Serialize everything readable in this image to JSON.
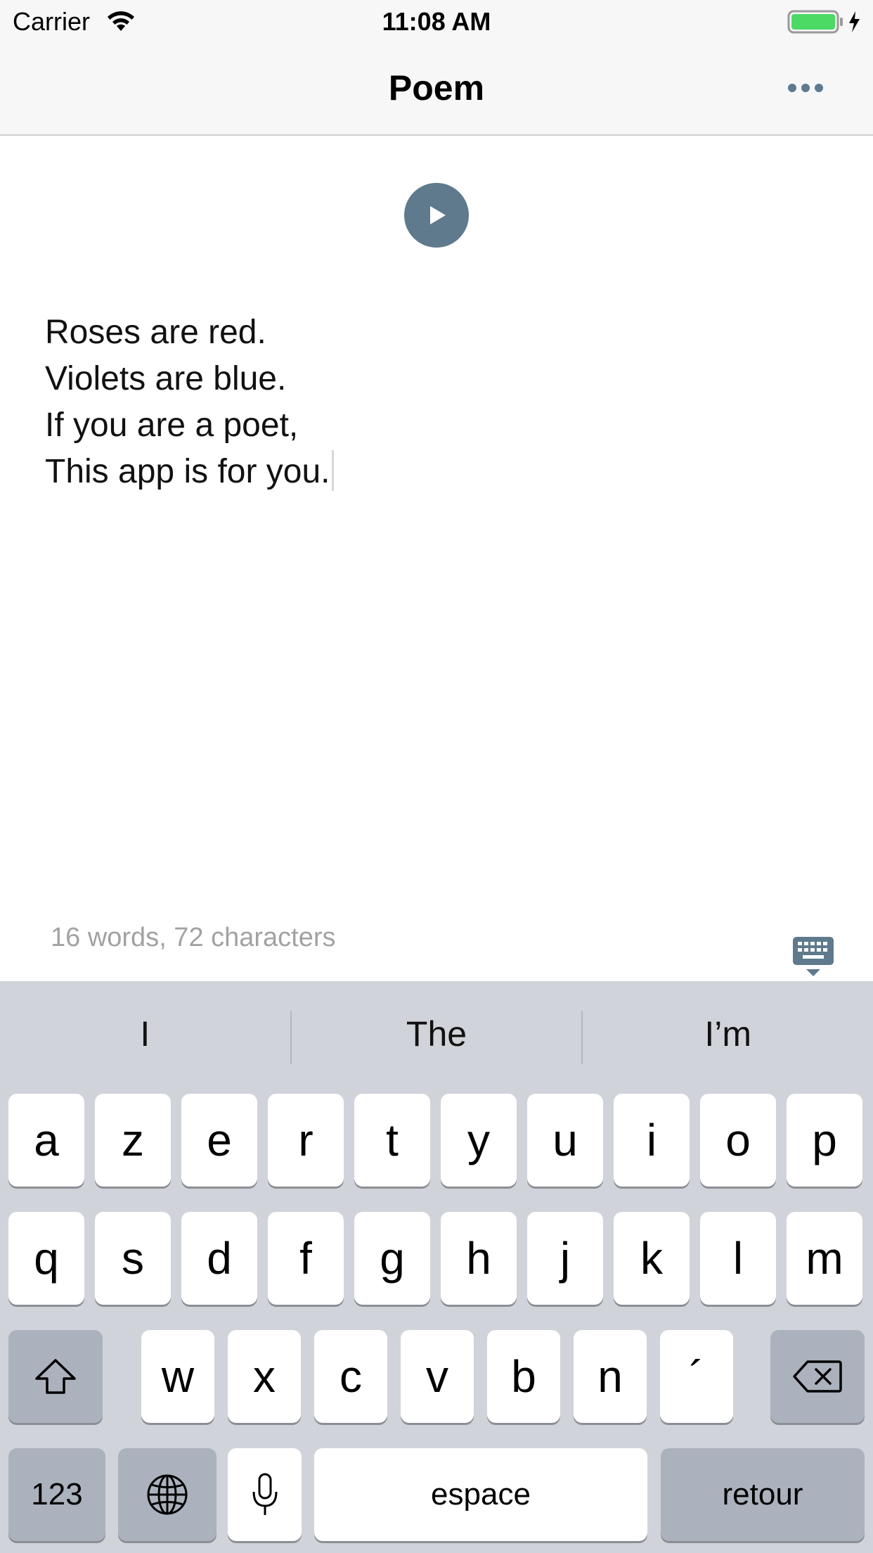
{
  "status_bar": {
    "carrier": "Carrier",
    "time": "11:08 AM",
    "wifi_icon": "wifi-icon",
    "battery_icon": "battery-charging-icon",
    "battery_color": "#4cd964"
  },
  "nav": {
    "title": "Poem",
    "more_icon": "more-dots-icon"
  },
  "content": {
    "play_icon": "play-icon",
    "accent_color": "#5e7a8c",
    "poem_lines": [
      "Roses are red.",
      "Violets are blue.",
      "If you are a poet,",
      "This app is for you."
    ],
    "word_count": "16 words, 72 characters",
    "keyboard_toggle_icon": "keyboard-dismiss-icon"
  },
  "keyboard": {
    "suggestions": [
      "I",
      "The",
      "I’m"
    ],
    "row1": [
      "a",
      "z",
      "e",
      "r",
      "t",
      "y",
      "u",
      "i",
      "o",
      "p"
    ],
    "row2": [
      "q",
      "s",
      "d",
      "f",
      "g",
      "h",
      "j",
      "k",
      "l",
      "m"
    ],
    "row3": [
      "w",
      "x",
      "c",
      "v",
      "b",
      "n",
      "´"
    ],
    "shift_icon": "shift-icon",
    "delete_icon": "backspace-icon",
    "numbers_label": "123",
    "globe_icon": "globe-icon",
    "mic_icon": "microphone-icon",
    "space_label": "espace",
    "return_label": "retour"
  }
}
